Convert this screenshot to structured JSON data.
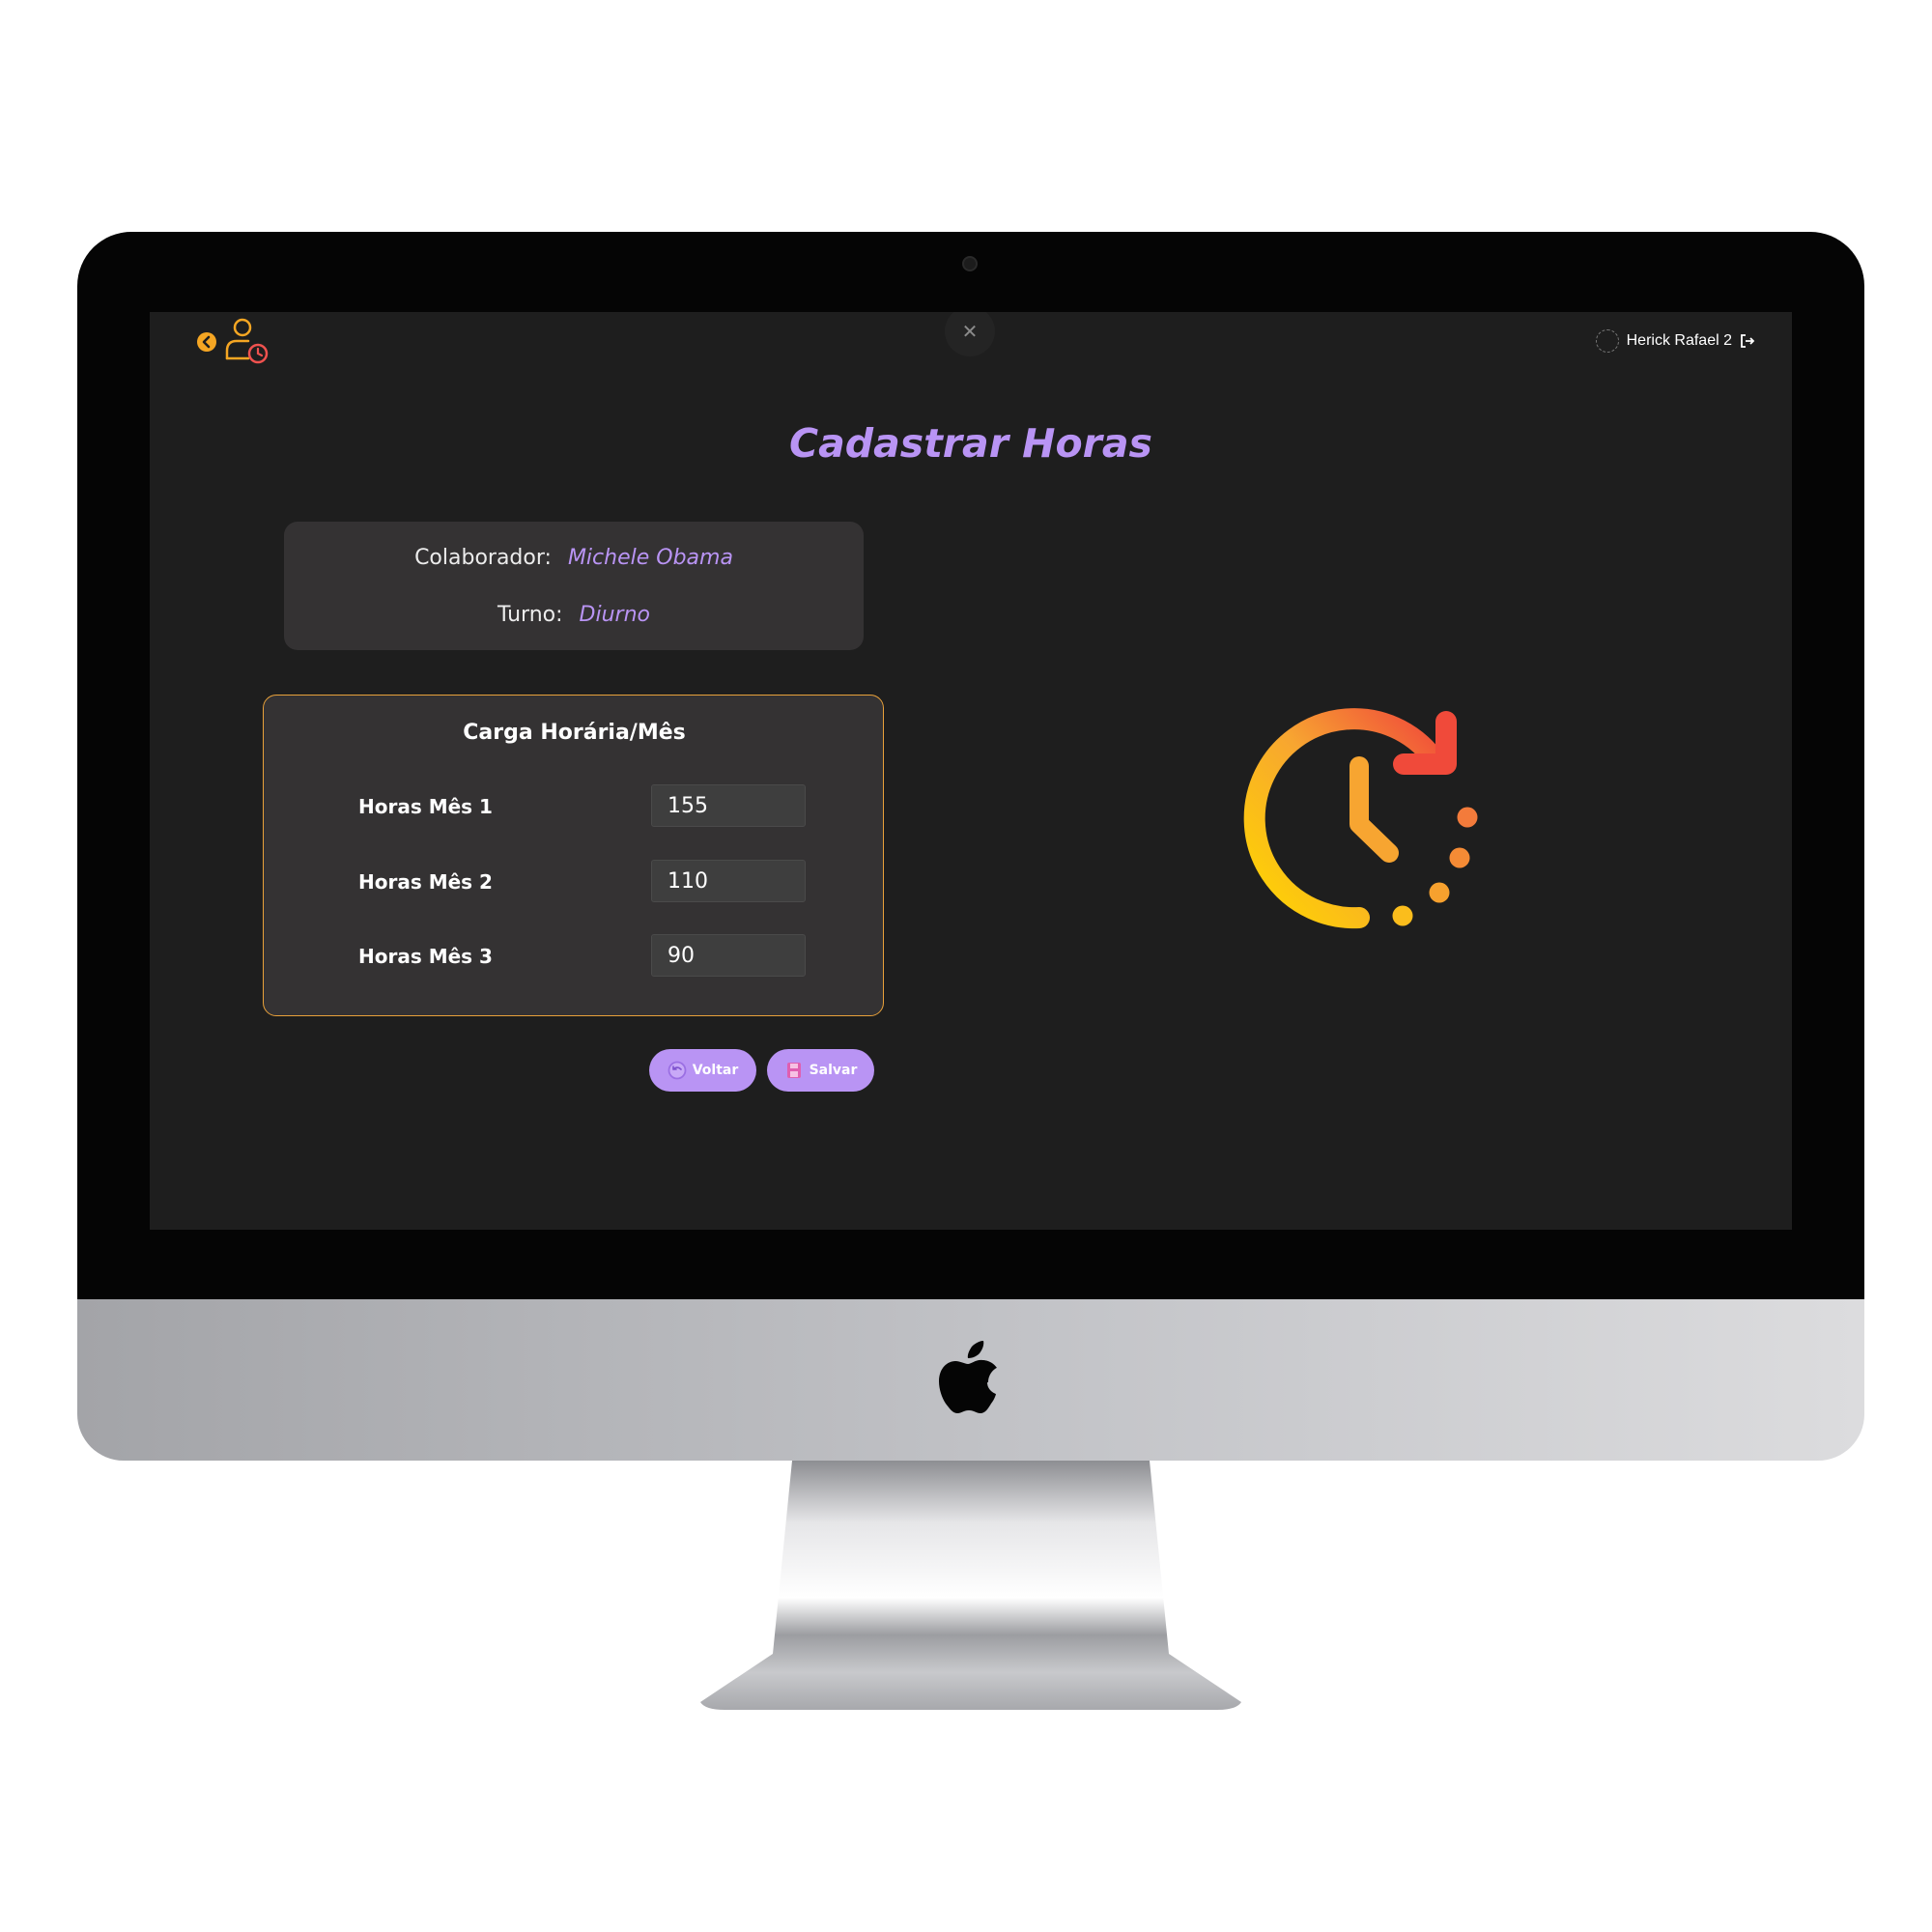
{
  "header": {
    "close_symbol": "✕",
    "user_name": "Herick Rafael 2"
  },
  "page": {
    "title": "Cadastrar Horas"
  },
  "info_card": {
    "collaborator_label": "Colaborador:",
    "collaborator_value": "Michele Obama",
    "shift_label": "Turno:",
    "shift_value": "Diurno"
  },
  "hours_card": {
    "title": "Carga Horária/Mês",
    "rows": [
      {
        "label": "Horas Mês 1",
        "value": "155"
      },
      {
        "label": "Horas Mês 2",
        "value": "110"
      },
      {
        "label": "Horas Mês 3",
        "value": "90"
      }
    ]
  },
  "actions": {
    "back_label": "Voltar",
    "save_label": "Salvar"
  },
  "colors": {
    "accent_purple": "#b994f4",
    "accent_orange": "#f5a623",
    "card_border": "#e8a13a",
    "screen_bg": "#1e1e1e",
    "card_bg": "#343233"
  },
  "icons": {
    "back": "chevron-left-circle-icon",
    "app": "user-clock-icon",
    "close": "close-icon",
    "logout": "logout-icon",
    "voltar": "undo-icon",
    "salvar": "floppy-disk-icon",
    "illustration": "clock-refresh-icon"
  }
}
